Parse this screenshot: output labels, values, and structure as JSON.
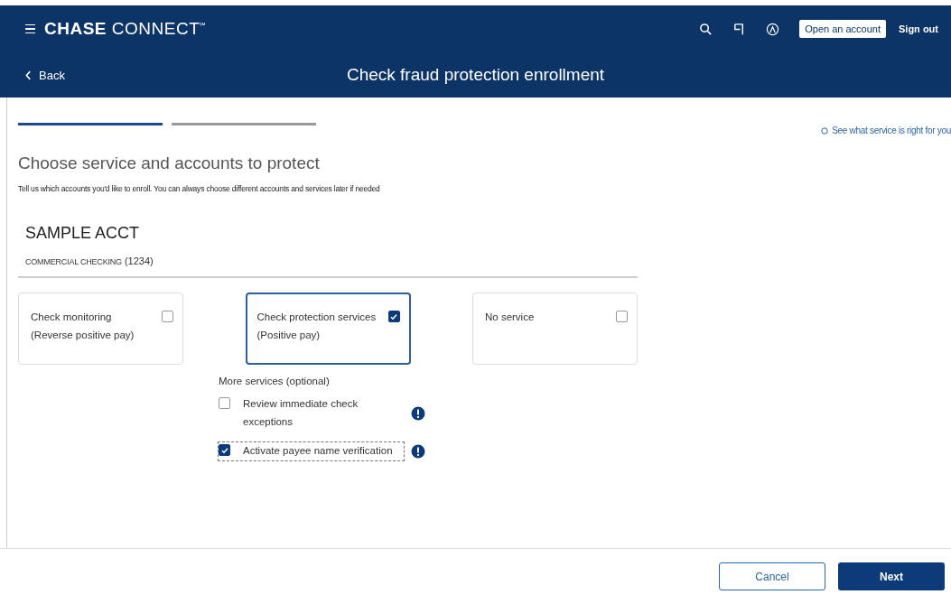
{
  "header": {
    "logo": "**CHASE** CONNECT$^{℠}$",
    "open_account": "Open an account",
    "sign_out": "Sign out",
    "back": "Back",
    "title": "Check fraud protection enrollment"
  },
  "steps": [
    {
      "selected": true
    },
    {
      "selected": false
    }
  ],
  "help_link": "See what service is right for you",
  "heading": "Choose service and accounts to protect",
  "subtitle": "Tell us which accounts you'd like to enroll. You can always choose different accounts and services later if needed",
  "account": {
    "name": "SAMPLE ACCT",
    "type": "COMMERCIAL CHECKING",
    "number": "(1234)"
  },
  "services": [
    {
      "label": "Check monitoring (Reverse positive pay)",
      "checked": false
    },
    {
      "label": "Check protection services (Positive pay)",
      "checked": true
    },
    {
      "label": "No service",
      "checked": false
    }
  ],
  "more_services": {
    "title": "More services (optional)",
    "options": [
      {
        "label": "Review immediate check exceptions",
        "checked": false,
        "focused": false
      },
      {
        "label": "Activate payee name verification",
        "checked": true,
        "focused": true
      }
    ]
  },
  "buttons": {
    "cancel": "Cancel",
    "next": "Next"
  }
}
